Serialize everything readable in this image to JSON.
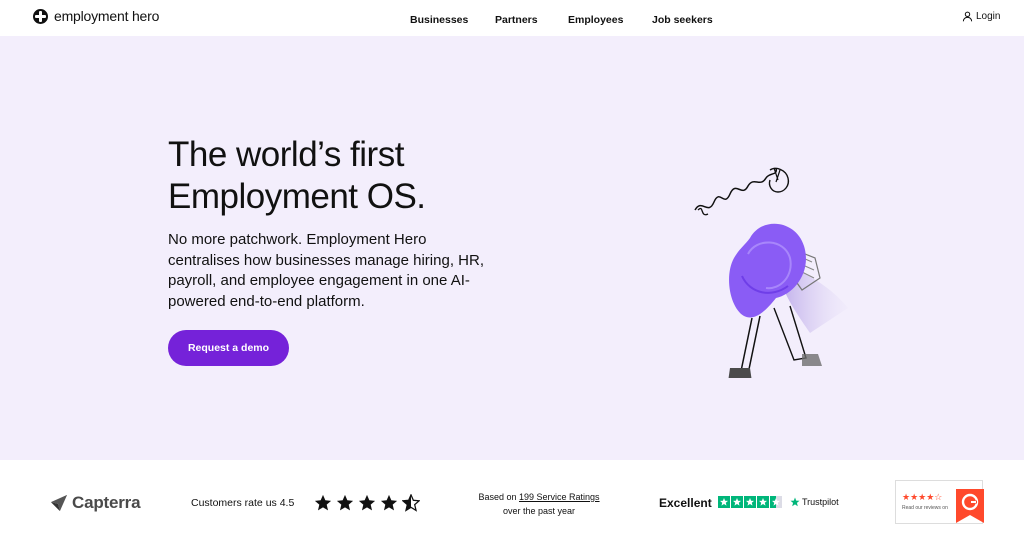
{
  "header": {
    "logo_text": "employment hero",
    "nav": [
      "Businesses",
      "Partners",
      "Employees",
      "Job seekers"
    ],
    "login_label": "Login"
  },
  "hero": {
    "headline_line1": "The world’s first",
    "headline_line2": "Employment OS.",
    "subcopy": "No more patchwork. Employment Hero centralises how businesses manage hiring, HR, payroll, and employee engagement in one AI-powered end-to-end platform.",
    "cta_label": "Request a demo",
    "colors": {
      "background": "#f3eefc",
      "accent": "#7522d9",
      "illustration": "#8a5cf5"
    }
  },
  "ratings": {
    "capterra_label": "Capterra",
    "customers_rate": "Customers rate us 4.5",
    "star_rating": 4.5,
    "based_on_prefix": "Based on",
    "service_ratings_link": "199 Service Ratings",
    "past_year": "over the past year",
    "trustpilot_rating_label": "Excellent",
    "trustpilot_brand": "Trustpilot",
    "g2_text": "Read our reviews on",
    "colors": {
      "trustpilot_green": "#00b67a",
      "g2_red": "#ff492c"
    }
  }
}
